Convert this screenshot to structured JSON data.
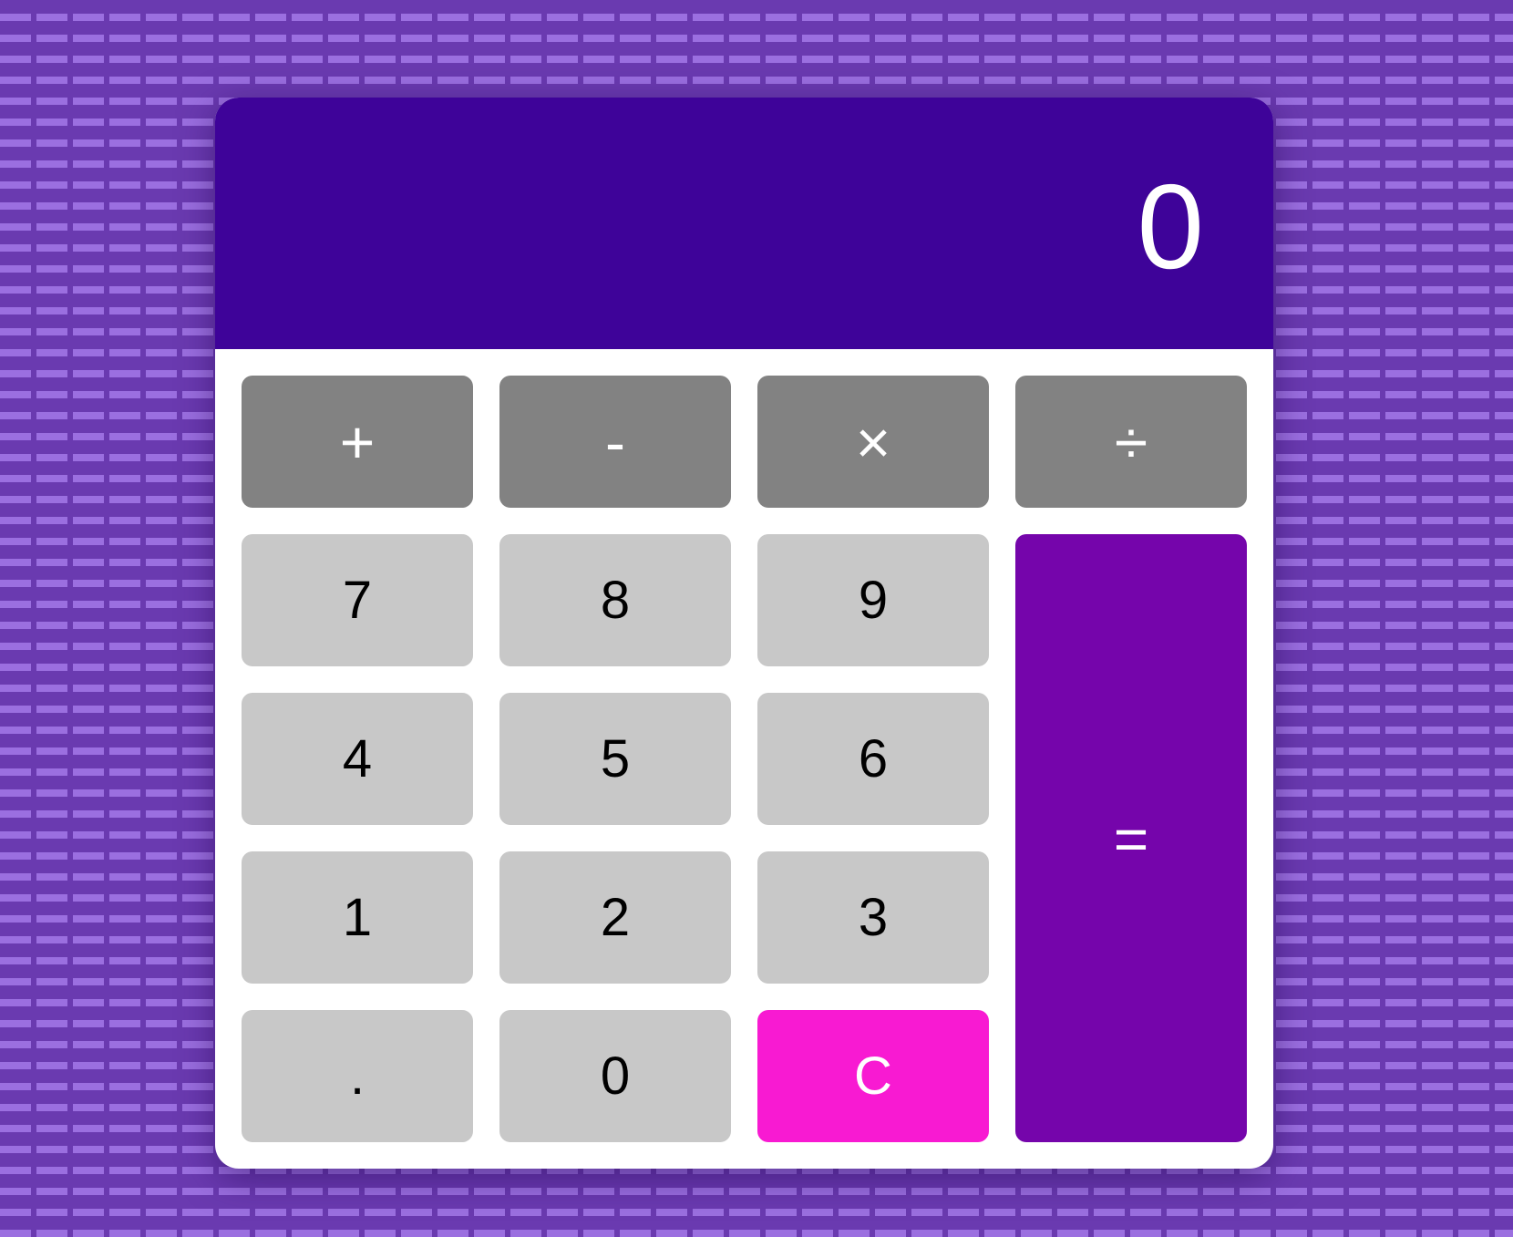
{
  "display": {
    "value": "0"
  },
  "operators": [
    {
      "label": "+",
      "name": "add-button"
    },
    {
      "label": "-",
      "name": "subtract-button"
    },
    {
      "label": "×",
      "name": "multiply-button"
    },
    {
      "label": "÷",
      "name": "divide-button"
    }
  ],
  "keys": {
    "seven": "7",
    "eight": "8",
    "nine": "9",
    "four": "4",
    "five": "5",
    "six": "6",
    "one": "1",
    "two": "2",
    "three": "3",
    "decimal": ".",
    "zero": "0",
    "clear": "C",
    "equals": "="
  },
  "colors": {
    "display_bg": "#3e0399",
    "operator_bg": "#828282",
    "number_bg": "#c8c8c8",
    "clear_bg": "#f81ad2",
    "equals_bg": "#7505ab",
    "background": "#6a3ab0"
  }
}
